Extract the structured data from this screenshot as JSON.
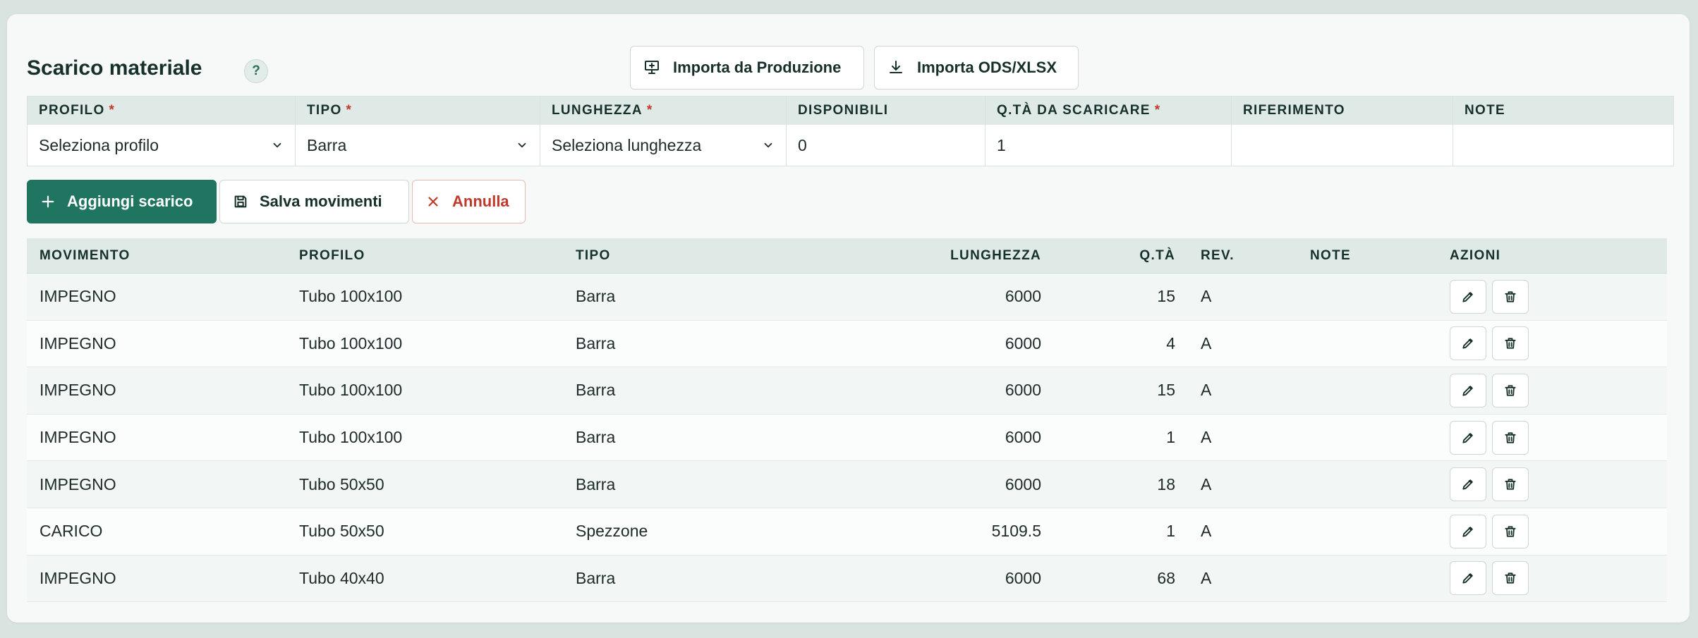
{
  "header": {
    "title": "Scarico materiale",
    "help": "?",
    "import_prod": "Importa da Produzione",
    "import_file": "Importa ODS/XLSX"
  },
  "form": {
    "fields": [
      {
        "label": "PROFILO",
        "required": true,
        "value": "Seleziona profilo",
        "select": true
      },
      {
        "label": "TIPO",
        "required": true,
        "value": "Barra",
        "select": true
      },
      {
        "label": "LUNGHEZZA",
        "required": true,
        "value": "Seleziona lunghezza",
        "select": true
      },
      {
        "label": "DISPONIBILI",
        "required": false,
        "value": "0",
        "select": false
      },
      {
        "label": "Q.TÀ DA SCARICARE",
        "required": true,
        "value": "1",
        "select": false
      },
      {
        "label": "RIFERIMENTO",
        "required": false,
        "value": "",
        "select": false
      },
      {
        "label": "NOTE",
        "required": false,
        "value": "",
        "select": false
      }
    ]
  },
  "actions": {
    "add": "Aggiungi scarico",
    "save": "Salva movimenti",
    "cancel": "Annulla"
  },
  "table": {
    "headers": [
      "MOVIMENTO",
      "PROFILO",
      "TIPO",
      "LUNGHEZZA",
      "Q.TÀ",
      "REV.",
      "NOTE",
      "AZIONI"
    ],
    "rows": [
      {
        "mov": "IMPEGNO",
        "prof": "Tubo 100x100",
        "tipo": "Barra",
        "lung": "6000",
        "qta": "15",
        "rev": "A",
        "note": ""
      },
      {
        "mov": "IMPEGNO",
        "prof": "Tubo 100x100",
        "tipo": "Barra",
        "lung": "6000",
        "qta": "4",
        "rev": "A",
        "note": ""
      },
      {
        "mov": "IMPEGNO",
        "prof": "Tubo 100x100",
        "tipo": "Barra",
        "lung": "6000",
        "qta": "15",
        "rev": "A",
        "note": ""
      },
      {
        "mov": "IMPEGNO",
        "prof": "Tubo 100x100",
        "tipo": "Barra",
        "lung": "6000",
        "qta": "1",
        "rev": "A",
        "note": ""
      },
      {
        "mov": "IMPEGNO",
        "prof": "Tubo 50x50",
        "tipo": "Barra",
        "lung": "6000",
        "qta": "18",
        "rev": "A",
        "note": ""
      },
      {
        "mov": "CARICO",
        "prof": "Tubo 50x50",
        "tipo": "Spezzone",
        "lung": "5109.5",
        "qta": "1",
        "rev": "A",
        "note": ""
      },
      {
        "mov": "IMPEGNO",
        "prof": "Tubo 40x40",
        "tipo": "Barra",
        "lung": "6000",
        "qta": "68",
        "rev": "A",
        "note": ""
      }
    ]
  }
}
